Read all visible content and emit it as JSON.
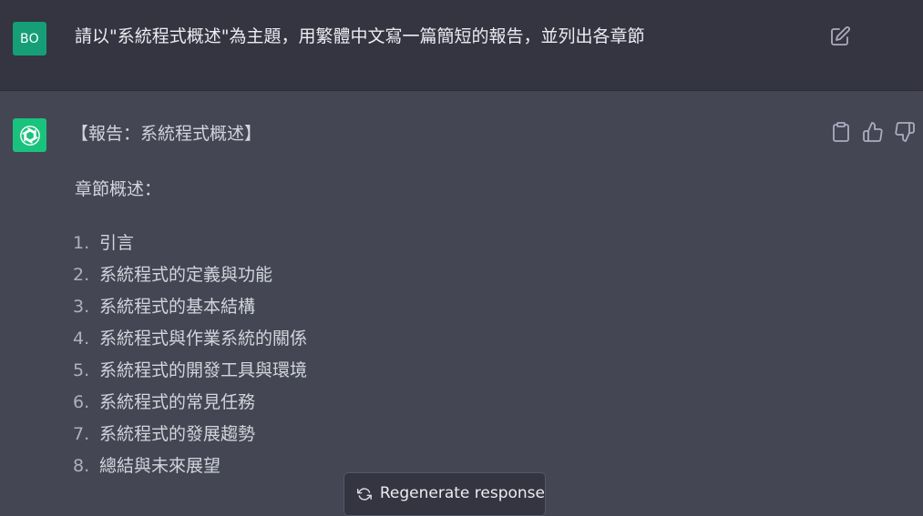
{
  "user_message": {
    "avatar_initials": "BO",
    "text": "請以\"系統程式概述\"為主題，用繁體中文寫一篇簡短的報告，並列出各章節"
  },
  "assistant_message": {
    "title": "【報告：系統程式概述】",
    "section_label": "章節概述：",
    "chapters": [
      {
        "num": "1.",
        "label": "引言"
      },
      {
        "num": "2.",
        "label": "系統程式的定義與功能"
      },
      {
        "num": "3.",
        "label": "系統程式的基本結構"
      },
      {
        "num": "4.",
        "label": "系統程式與作業系統的關係"
      },
      {
        "num": "5.",
        "label": "系統程式的開發工具與環境"
      },
      {
        "num": "6.",
        "label": "系統程式的常見任務"
      },
      {
        "num": "7.",
        "label": "系統程式的發展趨勢"
      },
      {
        "num": "8.",
        "label": "總結與未來展望"
      }
    ]
  },
  "regenerate": {
    "label": "Regenerate response",
    "icon": "refresh-icon"
  },
  "icons": {
    "edit": "edit-icon",
    "copy": "clipboard-icon",
    "like": "thumbs-up-icon",
    "dislike": "thumbs-down-icon",
    "assistant_logo": "openai-logo-icon"
  },
  "colors": {
    "user_bg": "#343541",
    "assistant_bg": "#444654",
    "user_avatar": "#169e77",
    "assistant_avatar": "#19c37d"
  }
}
